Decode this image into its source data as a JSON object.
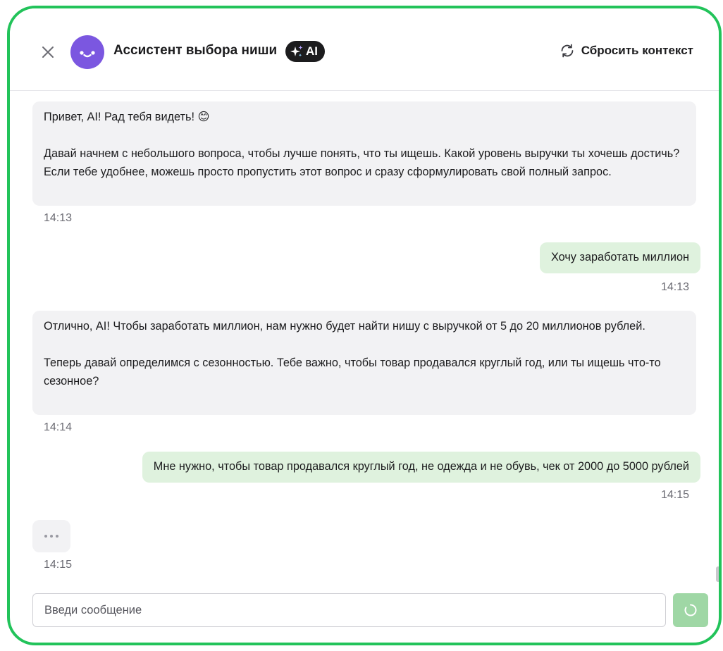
{
  "header": {
    "title": "Ассистент выбора ниши",
    "ai_badge": "AI",
    "reset_label": "Сбросить контекст",
    "icons": [
      "close-icon",
      "assistant-avatar",
      "sparkle-icon",
      "refresh-icon"
    ]
  },
  "messages": [
    {
      "role": "assistant",
      "paragraphs": [
        "Привет, AI! Рад тебя видеть! 😊",
        "Давай начнем с небольшого вопроса, чтобы лучше понять, что ты ищешь. Какой уровень выручки ты хочешь достичь? Если тебе удобнее, можешь просто пропустить этот вопрос и сразу сформулировать свой полный запрос."
      ],
      "time": "14:13"
    },
    {
      "role": "user",
      "text": "Хочу заработать миллион",
      "time": "14:13"
    },
    {
      "role": "assistant",
      "paragraphs": [
        "Отлично, AI! Чтобы заработать миллион, нам нужно будет найти нишу с выручкой от 5 до 20 миллионов рублей.",
        "Теперь давай определимся с сезонностью. Тебе важно, чтобы товар продавался круглый год, или ты ищешь что-то сезонное?"
      ],
      "time": "14:14"
    },
    {
      "role": "user",
      "text": "Мне нужно, чтобы товар продавался круглый год, не одежда и не обувь, чек от 2000 до 5000 рублей",
      "time": "14:15"
    },
    {
      "role": "assistant",
      "typing": true,
      "time": "14:15"
    }
  ],
  "composer": {
    "placeholder": "Введи сообщение",
    "value": ""
  },
  "colors": {
    "frame_border": "#22c35a",
    "avatar": "#7b57e0",
    "incoming_bubble": "#f2f2f4",
    "outgoing_bubble": "#dff2de",
    "send_button": "#9fd7a5"
  }
}
